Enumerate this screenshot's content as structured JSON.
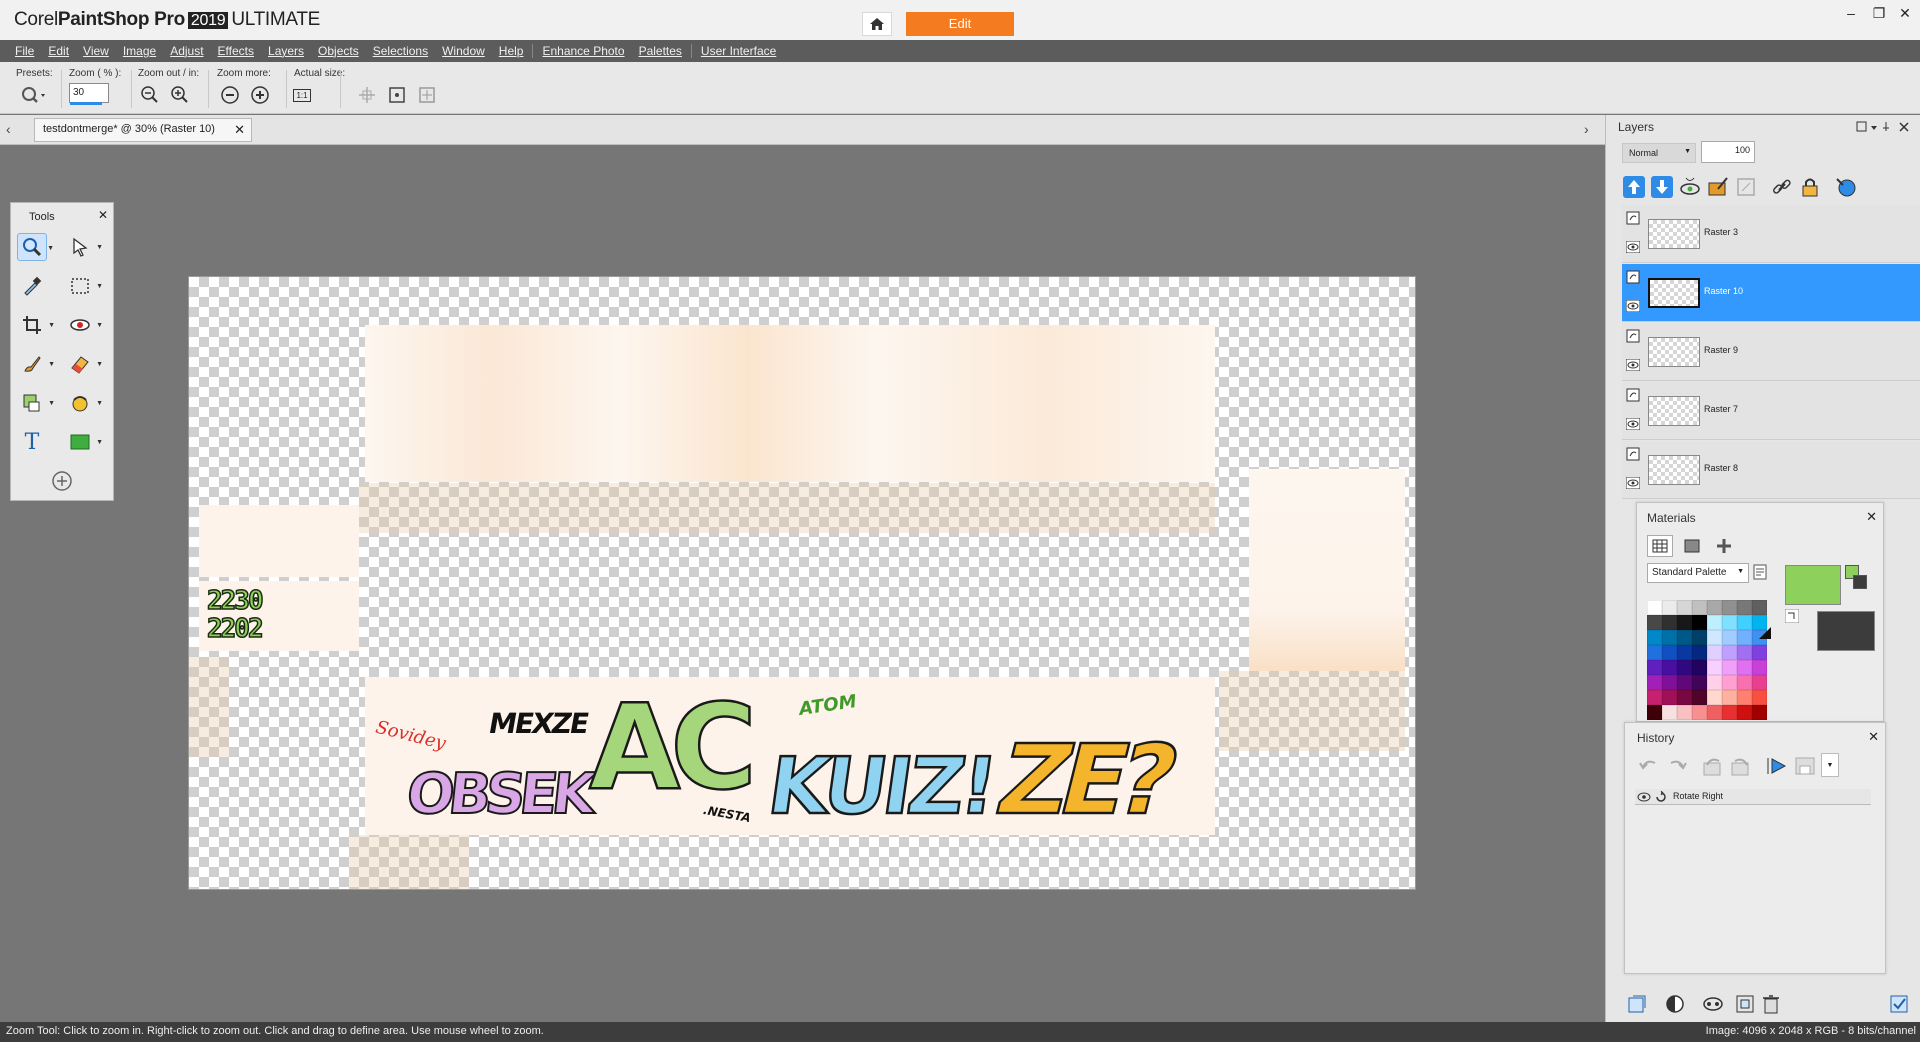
{
  "app": {
    "title_prefix": "Corel",
    "title_main": "PaintShop Pro",
    "title_year": "2019",
    "title_edition": "ULTIMATE",
    "home_icon": "home-icon",
    "edit_tab": "Edit",
    "accent_color": "#f47b20"
  },
  "window_controls": {
    "minimize": "–",
    "restore": "❐",
    "close": "✕"
  },
  "menu": {
    "items": [
      "File",
      "Edit",
      "View",
      "Image",
      "Adjust",
      "Effects",
      "Layers",
      "Objects",
      "Selections",
      "Window",
      "Help"
    ],
    "extra": [
      "Enhance Photo",
      "Palettes"
    ],
    "ui": "User Interface"
  },
  "tool_options": {
    "presets_label": "Presets:",
    "zoom_label": "Zoom ( % ):",
    "zoom_value": "30",
    "zoom_out_in_label": "Zoom out / in:",
    "zoom_more_label": "Zoom more:",
    "actual_size_label": "Actual size:",
    "actual_size_glyph": "1:1"
  },
  "document": {
    "tab_label": "testdontmerge* @  30% (Raster 10)",
    "close": "✕"
  },
  "tools_palette": {
    "title": "Tools",
    "close": "✕",
    "text_tool_glyph": "T"
  },
  "canvas_art": {
    "date_line1": "2230",
    "date_line2": "2202",
    "tag_small": "Sovidey",
    "tag_black": "MEXZE",
    "tag_green": "ATOM",
    "piece_1": "OBSEK",
    "piece_2": "AC",
    "piece_2_small": ".NESTA",
    "piece_3": "KUIZ!",
    "piece_4": "ZE?"
  },
  "layers": {
    "title": "Layers",
    "blend_mode": "Normal",
    "opacity": "100",
    "items": [
      {
        "name": "Raster 3",
        "selected": false
      },
      {
        "name": "Raster 10",
        "selected": true
      },
      {
        "name": "Raster 9",
        "selected": false
      },
      {
        "name": "Raster 7",
        "selected": false
      },
      {
        "name": "Raster 8",
        "selected": false
      }
    ],
    "selected_color": "#3399ff"
  },
  "materials": {
    "title": "Materials",
    "close": "✕",
    "palette": "Standard Palette",
    "foreground_color": "#8ed05c",
    "background_color": "#3c3c3c"
  },
  "history": {
    "title": "History",
    "close": "✕",
    "items": [
      "Rotate Right"
    ]
  },
  "status": {
    "left": "Zoom Tool: Click to zoom in. Right-click to zoom out. Click and drag to define area. Use mouse wheel to zoom.",
    "right": "Image:  4096 x 2048 x RGB - 8 bits/channel"
  }
}
